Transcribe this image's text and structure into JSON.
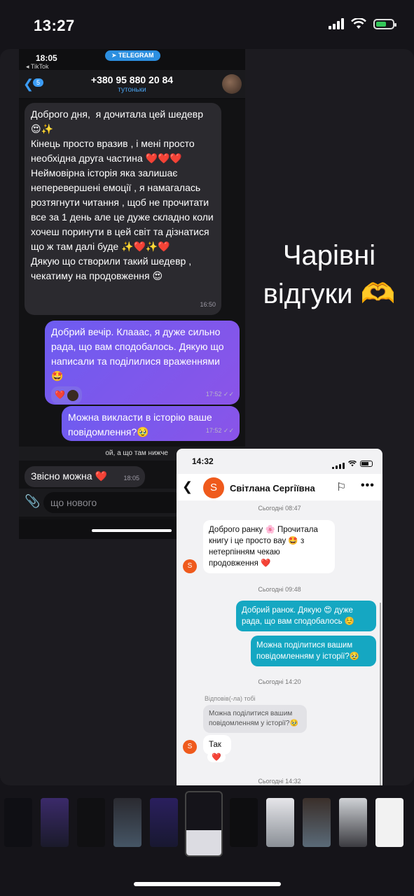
{
  "status": {
    "time": "13:27"
  },
  "telegram": {
    "time": "18:05",
    "back_app": "◂ TikTok",
    "badge": "TELEGRAM",
    "back_count": "5",
    "phone": "+380 95 880 20 84",
    "subtitle": "тутоньки",
    "messages": [
      {
        "text": "Доброго дня,  я дочитала цей шедевр 😍✨\nКінець просто вразив , і мені просто необхідна друга частина ❤️❤️❤️\nНеймовірна історія яка залишає неперевершені емоції , я намагалась розтягнути читання , щоб не прочитати все за 1 день але це дуже складно коли хочеш поринути в цей світ та дізнатися що ж там далі буде ✨❤️✨❤️\nДякую що створили такий шедевр , чекатиму на продовження 😍",
        "time": "16:50"
      },
      {
        "text": "Добрий вечір. Клааас, я дуже сильно рада, що вам сподобалось. Дякую що написали та поділилися враженнями 🤩",
        "time": "17:52",
        "reaction": "❤️"
      },
      {
        "text": "Можна викласти в історію ваше повідомлення?🥹",
        "time": "17:52"
      },
      {
        "text": "Звісно можна ❤️",
        "time": "18:05"
      }
    ],
    "reply_preview": "ой, а що там нижче",
    "input_placeholder": "що нового"
  },
  "caption": "Чарівні відгуки 🫶",
  "second": {
    "time": "14:32",
    "name": "Світлана Сергіївна",
    "avatar_letter": "S",
    "dates": [
      "Сьогодні 08:47",
      "Сьогодні 09:48",
      "Сьогодні 14:20",
      "Сьогодні 14:32"
    ],
    "msg_in_1": "Доброго ранку 🌸 Прочитала книгу і це просто вау 🤩 з нетерпінням чекаю продовження ❤️",
    "msg_out_1": "Добрий ранок. Дякую 😍 дуже рада, що вам сподобалось ☺️",
    "msg_out_2": "Можна поділитися вашим повідомленням у історії?🥹",
    "replied_label": "Відповів(-ла) тобі",
    "quote": "Можна поділитися вашим повідомленням у історії?🥹",
    "msg_in_2": "Так",
    "msg_in_2_reaction": "❤️"
  },
  "colors": {
    "accent_purple": "#7a5af0",
    "accent_teal": "#15a7c2",
    "avatar_orange": "#ef5a1c"
  }
}
